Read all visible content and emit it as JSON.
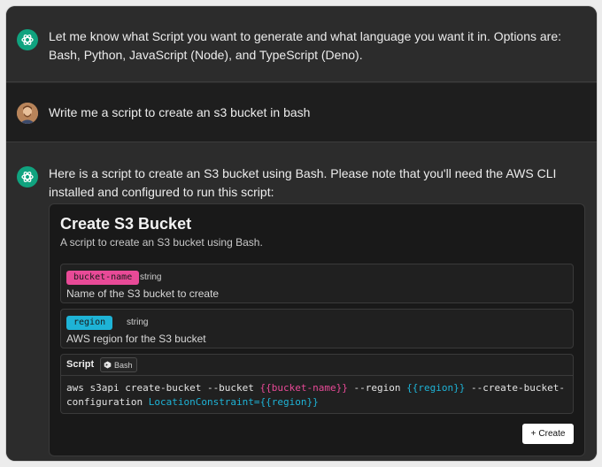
{
  "messages": [
    {
      "role": "assistant",
      "text": "Let me know what Script you want to generate and what language you want it in. Options are: Bash, Python, JavaScript (Node), and TypeScript (Deno)."
    },
    {
      "role": "user",
      "text": "Write me a script to create an s3 bucket in bash"
    },
    {
      "role": "assistant",
      "text": "Here is a script to create an S3 bucket using Bash. Please note that you'll need the AWS CLI installed and configured to run this script:"
    }
  ],
  "card": {
    "title": "Create S3 Bucket",
    "description": "A script to create an S3 bucket using Bash.",
    "params": [
      {
        "name": "bucket-name",
        "type": "string",
        "description": "Name of the S3 bucket to create",
        "color": "#e84a97"
      },
      {
        "name": "region",
        "type": "string",
        "description": "AWS region for the S3 bucket",
        "color": "#1eb3d6"
      }
    ],
    "script": {
      "label": "Script",
      "language": "Bash",
      "code": {
        "part1": "aws s3api create-bucket --bucket ",
        "var1": "{{bucket-name}}",
        "part2": " --region ",
        "var2": "{{region}}",
        "part3": " --create-bucket-",
        "part4": "configuration ",
        "part5": "LocationConstraint=",
        "var3": "{{region}}"
      }
    },
    "create_button": {
      "icon": "+",
      "label": "Create"
    }
  },
  "icons": {
    "assistant": "openai-logo-icon",
    "user": "user-avatar-photo",
    "language": "bash-icon"
  }
}
